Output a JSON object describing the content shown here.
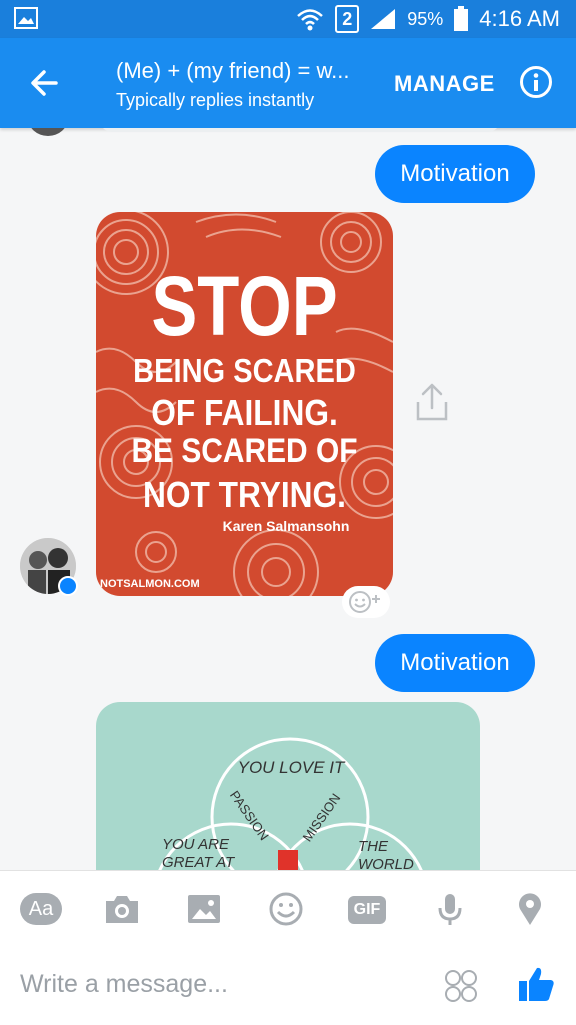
{
  "status": {
    "sim": "2",
    "battery": "95%",
    "time": "4:16 AM"
  },
  "header": {
    "title": "(Me) + (my friend) = w...",
    "subtitle": "Typically replies instantly",
    "manage": "MANAGE"
  },
  "messages": {
    "m1": "Motivation",
    "m2": "Motivation",
    "quote": {
      "l1": "STOP",
      "l2": "BEING SCARED",
      "l3": "OF FAILING.",
      "l4": "BE SCARED OF",
      "l5": "NOT TRYING.",
      "author": "Karen Salmansohn",
      "site": "NOTSALMON.COM"
    },
    "venn": {
      "top": "YOU LOVE IT",
      "left": "YOU ARE GREAT AT IT",
      "right": "THE WORLD NEEDS IT",
      "passion": "PASSION",
      "mission": "MISSION"
    }
  },
  "composer": {
    "aa": "Aa",
    "gif": "GIF",
    "placeholder": "Write a message..."
  }
}
